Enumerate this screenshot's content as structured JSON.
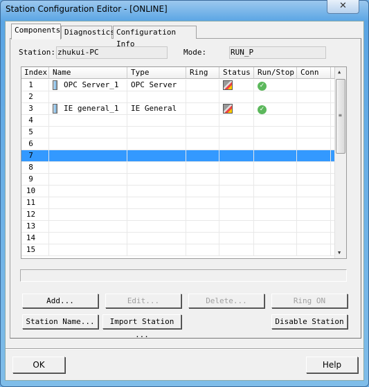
{
  "window": {
    "title": "Station Configuration Editor - [ONLINE]",
    "close_icon": "close-icon"
  },
  "tabs": [
    {
      "label": "Components",
      "active": true
    },
    {
      "label": "Diagnostics"
    },
    {
      "label": "Configuration Info"
    }
  ],
  "station": {
    "label": "Station:",
    "value": "zhukui-PC"
  },
  "mode": {
    "label": "Mode:",
    "value": "RUN_P"
  },
  "table": {
    "columns": [
      "Index",
      "Name",
      "Type",
      "Ring",
      "Status",
      "Run/Stop",
      "Conn"
    ],
    "selected_index": 7,
    "rows": [
      {
        "index": "1",
        "name": "OPC Server_1",
        "type": "OPC Server",
        "icon": "opc-server-icon",
        "status_icon": "status-icon",
        "run_stop": "run-ok-icon"
      },
      {
        "index": "2"
      },
      {
        "index": "3",
        "name": "IE general_1",
        "type": "IE General",
        "icon": "ie-general-icon",
        "status_icon": "status-icon",
        "run_stop": "run-ok-icon"
      },
      {
        "index": "4"
      },
      {
        "index": "5"
      },
      {
        "index": "6"
      },
      {
        "index": "7"
      },
      {
        "index": "8"
      },
      {
        "index": "9"
      },
      {
        "index": "10"
      },
      {
        "index": "11"
      },
      {
        "index": "12"
      },
      {
        "index": "13"
      },
      {
        "index": "14"
      },
      {
        "index": "15"
      }
    ]
  },
  "buttons": {
    "add": "Add...",
    "edit": "Edit...",
    "delete": "Delete...",
    "ring_on": "Ring ON",
    "station_name": "Station Name...",
    "import_station": "Import Station ...",
    "disable_station": "Disable Station",
    "ok": "OK",
    "help": "Help"
  },
  "colors": {
    "selection": "#3399ff",
    "title_bar": "#5aa5e4"
  }
}
